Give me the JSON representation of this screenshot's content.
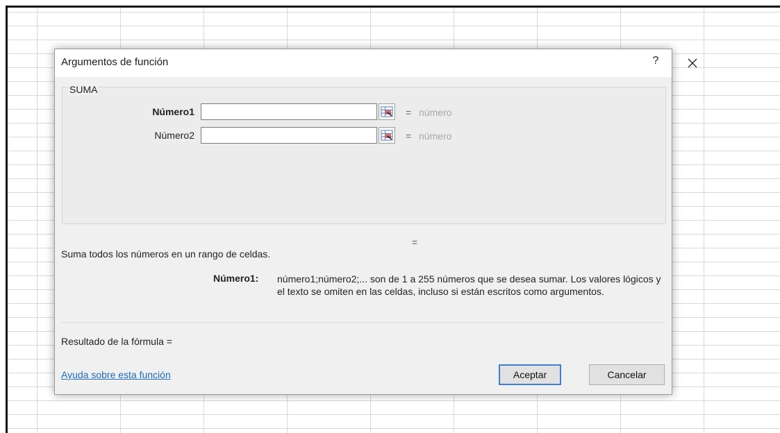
{
  "dialog": {
    "title": "Argumentos de función",
    "help_label": "?",
    "close_label": "✕"
  },
  "function_name": "SUMA",
  "arguments": [
    {
      "label": "Número1",
      "value": "",
      "equals": "=",
      "result_hint": "número"
    },
    {
      "label": "Número2",
      "value": "",
      "equals": "=",
      "result_hint": "número"
    }
  ],
  "function_result_equals": "=",
  "function_description": "Suma todos los números en un rango de celdas.",
  "argument_help": {
    "label": "Número1:",
    "text": "número1;número2;... son de 1 a 255 números que se desea sumar. Los valores lógicos y el texto se omiten en las celdas, incluso si están escritos como argumentos."
  },
  "formula_result": "Resultado de la fórmula =",
  "help_link": "Ayuda sobre esta función",
  "buttons": {
    "ok": "Aceptar",
    "cancel": "Cancelar"
  },
  "icons": {
    "ref_button": "range-select-icon"
  }
}
